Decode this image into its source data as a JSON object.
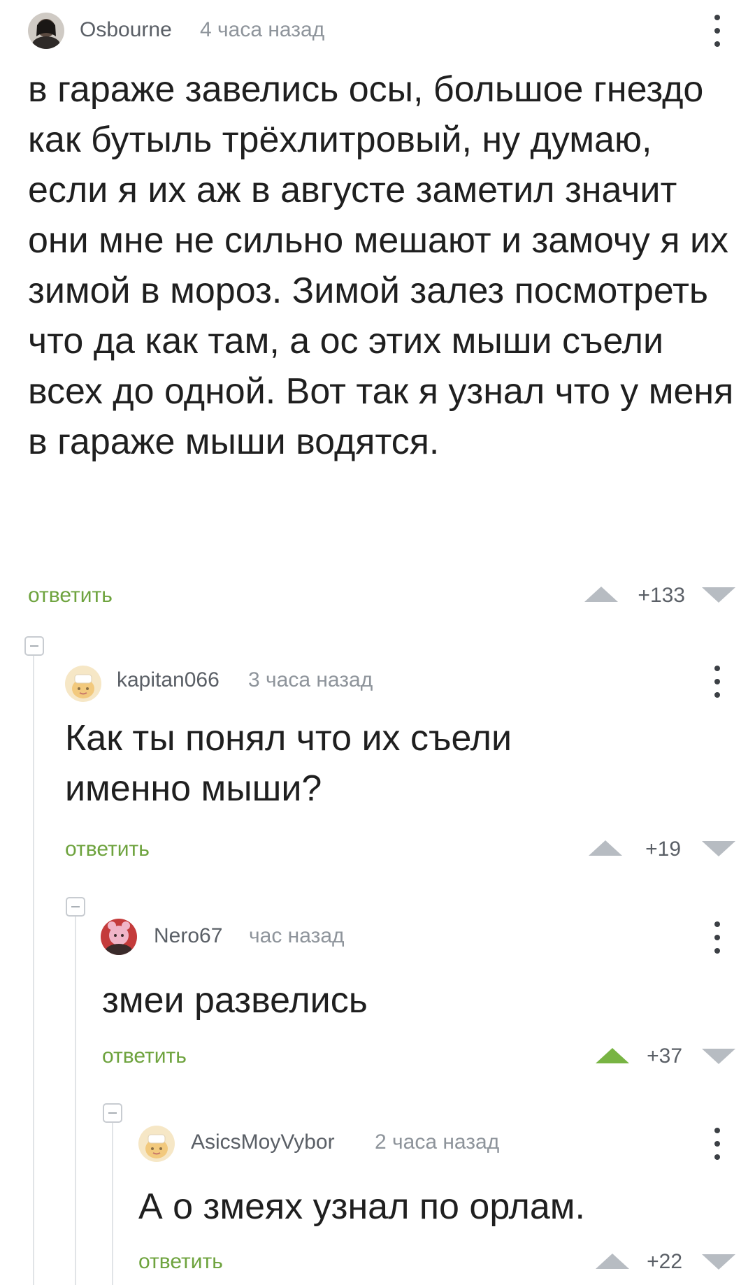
{
  "comments": [
    {
      "author": "Osbourne",
      "time": "4 часа назад",
      "text": "в гараже завелись осы, большое гнездо как бутыль трёхлитровый, ну думаю, если я их аж в августе заметил значит они мне не сильно мешают и замочу я их зимой в мороз. Зимой залез посмотреть что да как там, а ос этих мыши съели всех до одной. Вот так я узнал что у меня в гараже мыши водятся.",
      "reply_label": "ответить",
      "score": "+133",
      "upvoted": false
    },
    {
      "author": "kapitan066",
      "time": "3 часа назад",
      "text": "Как ты понял что их съели именно мыши?",
      "reply_label": "ответить",
      "score": "+19",
      "upvoted": false
    },
    {
      "author": "Nero67",
      "time": "час назад",
      "text": "змеи развелись",
      "reply_label": "ответить",
      "score": "+37",
      "upvoted": true
    },
    {
      "author": "AsicsMoyVybor",
      "time": "2 часа назад",
      "text": "А о змеях узнал по орлам.",
      "reply_label": "ответить",
      "score": "+22",
      "upvoted": false
    }
  ],
  "colors": {
    "accent_green": "#6ea33e",
    "upvote_active": "#78b443",
    "vote_inactive": "#b7bcc2",
    "text": "#1f1f1f",
    "meta": "#8e949b"
  },
  "icons": {
    "menu": "more-vertical-icon",
    "upvote": "triangle-up-icon",
    "downvote": "triangle-down-icon",
    "collapse": "minus-square-icon"
  }
}
